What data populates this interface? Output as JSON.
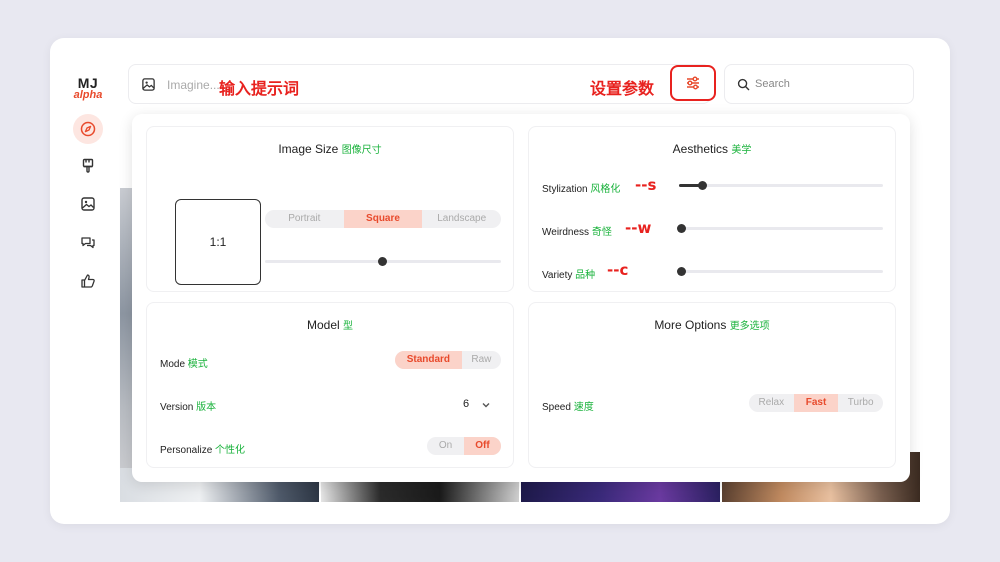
{
  "logo": {
    "mj": "MJ",
    "alpha": "alpha"
  },
  "sidebar": {
    "items": [
      {
        "icon": "compass-icon",
        "active": true
      },
      {
        "icon": "brush-icon",
        "active": false
      },
      {
        "icon": "image-icon",
        "active": false
      },
      {
        "icon": "chat-icon",
        "active": false
      },
      {
        "icon": "thumbs-up-icon",
        "active": false
      }
    ]
  },
  "prompt": {
    "placeholder": "Imagine...",
    "annotation": "输入提示词"
  },
  "settings": {
    "annotation": "设置参数",
    "icon": "sliders-icon"
  },
  "search": {
    "placeholder": "Search"
  },
  "image_size": {
    "title": "Image Size",
    "title_zh": "图像尺寸",
    "ratio": "1:1",
    "orientations": [
      "Portrait",
      "Square",
      "Landscape"
    ],
    "selected": "Square",
    "slider_value": 0.5
  },
  "aesthetics": {
    "title": "Aesthetics",
    "title_zh": "美学",
    "sliders": [
      {
        "label": "Stylization",
        "label_zh": "风格化",
        "flag": "--s",
        "value": 0.11
      },
      {
        "label": "Weirdness",
        "label_zh": "奇怪",
        "flag": "--w",
        "value": 0.0
      },
      {
        "label": "Variety",
        "label_zh": "品种",
        "flag": "--c",
        "value": 0.0
      }
    ]
  },
  "model": {
    "title": "Model",
    "title_zh": "型",
    "mode": {
      "label": "Mode",
      "label_zh": "模式",
      "options": [
        "Standard",
        "Raw"
      ],
      "selected": "Standard"
    },
    "version": {
      "label": "Version",
      "label_zh": "版本",
      "value": "6"
    },
    "personalize": {
      "label": "Personalize",
      "label_zh": "个性化",
      "options": [
        "On",
        "Off"
      ],
      "selected": "Off"
    }
  },
  "more_options": {
    "title": "More Options",
    "title_zh": "更多选项",
    "speed": {
      "label": "Speed",
      "label_zh": "速度",
      "options": [
        "Relax",
        "Fast",
        "Turbo"
      ],
      "selected": "Fast"
    }
  },
  "colors": {
    "accent": "#e84a2c",
    "accent_bg": "#fbd3c9",
    "annotation": "#e8221f",
    "zh_text": "#19b23b"
  }
}
